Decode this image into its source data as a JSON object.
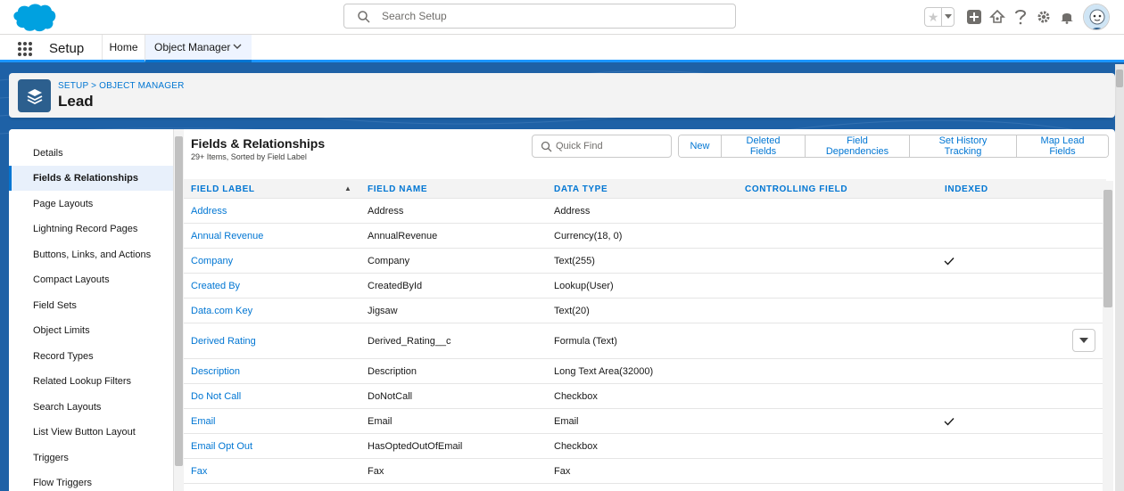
{
  "header": {
    "search_placeholder": "Search Setup",
    "icons": [
      "salesforce-cloud-logo",
      "star-icon",
      "add-icon",
      "trailhead-icon",
      "help-icon",
      "gear-icon",
      "bell-icon",
      "avatar"
    ]
  },
  "context_bar": {
    "app_name": "Setup",
    "tabs": [
      {
        "label": "Home"
      },
      {
        "label": "Object Manager",
        "active": true
      }
    ]
  },
  "page_header": {
    "breadcrumb": "SETUP > OBJECT MANAGER",
    "title": "Lead"
  },
  "sidebar": {
    "items": [
      {
        "label": "Details"
      },
      {
        "label": "Fields & Relationships",
        "active": true
      },
      {
        "label": "Page Layouts"
      },
      {
        "label": "Lightning Record Pages"
      },
      {
        "label": "Buttons, Links, and Actions"
      },
      {
        "label": "Compact Layouts"
      },
      {
        "label": "Field Sets"
      },
      {
        "label": "Object Limits"
      },
      {
        "label": "Record Types"
      },
      {
        "label": "Related Lookup Filters"
      },
      {
        "label": "Search Layouts"
      },
      {
        "label": "List View Button Layout"
      },
      {
        "label": "Triggers"
      },
      {
        "label": "Flow Triggers"
      }
    ]
  },
  "section": {
    "title": "Fields & Relationships",
    "subtitle": "29+ Items, Sorted by Field Label",
    "quick_find_placeholder": "Quick Find",
    "buttons": [
      "New",
      "Deleted Fields",
      "Field Dependencies",
      "Set History Tracking",
      "Map Lead Fields"
    ]
  },
  "table": {
    "columns": [
      "FIELD LABEL",
      "FIELD NAME",
      "DATA TYPE",
      "CONTROLLING FIELD",
      "INDEXED"
    ],
    "rows": [
      {
        "label": "Address",
        "name": "Address",
        "type": "Address",
        "controlling": "",
        "indexed": false
      },
      {
        "label": "Annual Revenue",
        "name": "AnnualRevenue",
        "type": "Currency(18, 0)",
        "controlling": "",
        "indexed": false
      },
      {
        "label": "Company",
        "name": "Company",
        "type": "Text(255)",
        "controlling": "",
        "indexed": true
      },
      {
        "label": "Created By",
        "name": "CreatedById",
        "type": "Lookup(User)",
        "controlling": "",
        "indexed": false
      },
      {
        "label": "Data.com Key",
        "name": "Jigsaw",
        "type": "Text(20)",
        "controlling": "",
        "indexed": false
      },
      {
        "label": "Derived Rating",
        "name": "Derived_Rating__c",
        "type": "Formula (Text)",
        "controlling": "",
        "indexed": false,
        "has_action": true
      },
      {
        "label": "Description",
        "name": "Description",
        "type": "Long Text Area(32000)",
        "controlling": "",
        "indexed": false
      },
      {
        "label": "Do Not Call",
        "name": "DoNotCall",
        "type": "Checkbox",
        "controlling": "",
        "indexed": false
      },
      {
        "label": "Email",
        "name": "Email",
        "type": "Email",
        "controlling": "",
        "indexed": true
      },
      {
        "label": "Email Opt Out",
        "name": "HasOptedOutOfEmail",
        "type": "Checkbox",
        "controlling": "",
        "indexed": false
      },
      {
        "label": "Fax",
        "name": "Fax",
        "type": "Fax",
        "controlling": "",
        "indexed": false
      }
    ]
  },
  "colors": {
    "brand_blue": "#0176d3",
    "band_blue": "#1e61a6",
    "accent_bar": "#1b96ff"
  }
}
